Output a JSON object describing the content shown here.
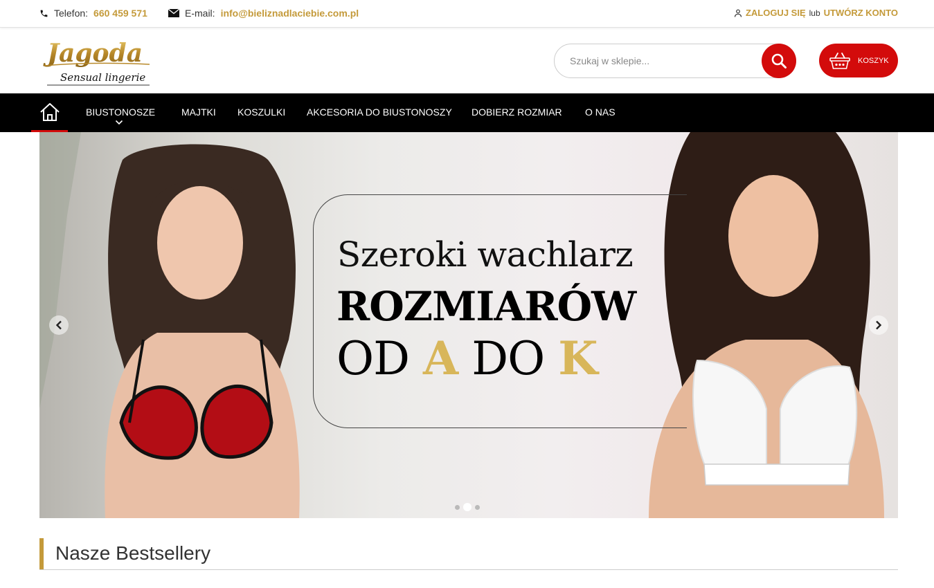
{
  "topbar": {
    "phone_label": "Telefon:",
    "phone": "660 459 571",
    "email_label": "E-mail:",
    "email": "info@bieliznadlaciebie.com.pl",
    "login": "ZALOGUJ SIĘ",
    "or": "lub",
    "register": "UTWÓRZ KONTO"
  },
  "logo": {
    "name": "Jagoda",
    "tagline": "Sensual lingerie"
  },
  "search": {
    "placeholder": "Szukaj w sklepie..."
  },
  "cart": {
    "label": "KOSZYK"
  },
  "nav": {
    "items": [
      "BIUSTONOSZE",
      "MAJTKI",
      "KOSZULKI",
      "AKCESORIA DO BIUSTONOSZY",
      "DOBIERZ ROZMIAR",
      "O NAS"
    ]
  },
  "slider": {
    "line1": "Szeroki wachlarz",
    "line2": "ROZMIARÓW",
    "line3_a": "OD ",
    "line3_b": "A",
    "line3_c": " DO ",
    "line3_d": "K",
    "dots_count": 3,
    "active_dot": 2
  },
  "section": {
    "title": "Nasze Bestsellery"
  },
  "colors": {
    "gold": "#c49a3a",
    "red": "#d30b0b",
    "nav_bg": "#000000"
  }
}
